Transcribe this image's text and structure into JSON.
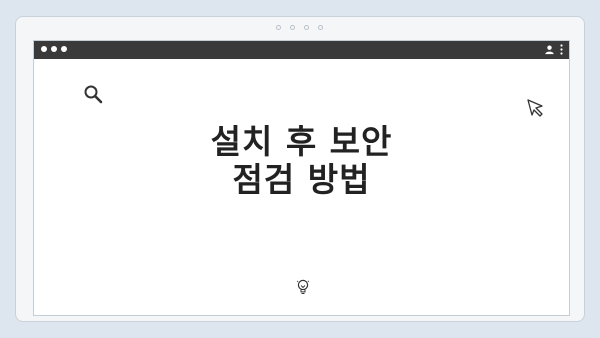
{
  "headline": {
    "line1": "설치 후 보안",
    "line2": "점검 방법"
  },
  "icons": {
    "search": "search-icon",
    "cursor": "cursor-arrow-icon",
    "bulb": "lightbulb-icon",
    "user": "user-icon",
    "menu": "kebab-menu-icon"
  },
  "colors": {
    "background": "#dde5ee",
    "titlebar": "#3a3a3a",
    "text": "#222222"
  }
}
